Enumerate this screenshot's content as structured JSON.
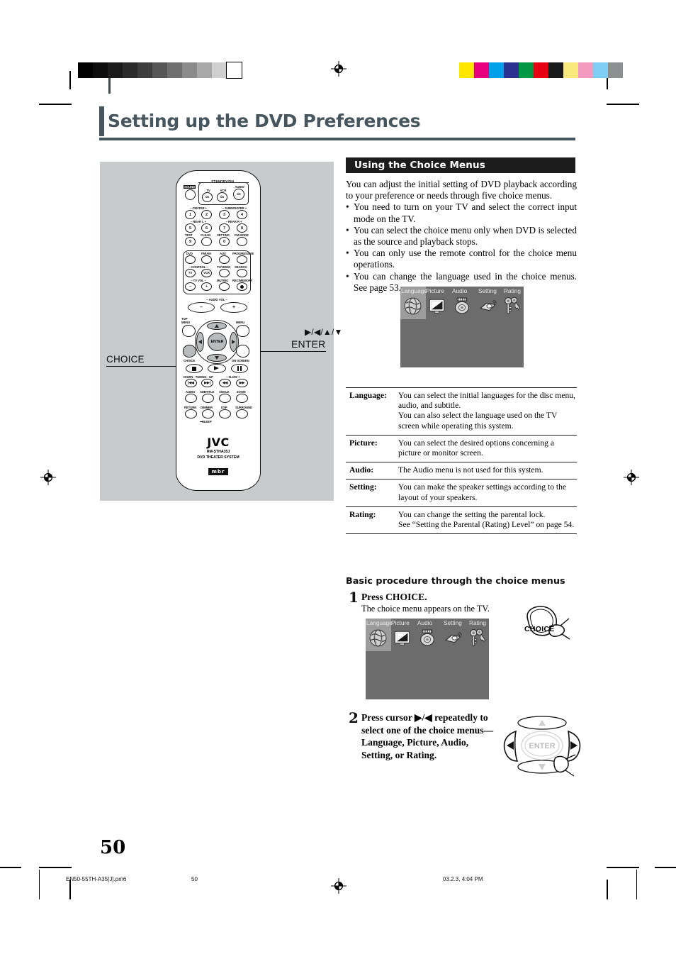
{
  "page": {
    "title": "Setting up the DVD Preferences",
    "number": "50"
  },
  "footer": {
    "file": "EN50-55TH-A35[J].pm6",
    "page": "50",
    "timestamp": "03.2.3, 4:04 PM"
  },
  "section": {
    "heading": "Using the Choice Menus",
    "intro_p1": "You can adjust the initial setting of DVD playback according to your preference or needs through five choice menus.",
    "bullets": [
      "You need to turn on your TV and select the correct input mode on the TV.",
      "You can select the choice menu only when DVD is selected as the source and playback stops.",
      "You can only use the remote control for the choice menu operations.",
      "You can change the language used in the choice menus. See page 53."
    ]
  },
  "tv_menu": {
    "tabs": [
      "Language",
      "Picture",
      "Audio",
      "Setting",
      "Rating"
    ],
    "selected": "Language",
    "icons": [
      "globe-icon",
      "monitor-icon",
      "disc-icon",
      "speaker-icon",
      "keys-icon"
    ],
    "bg_color": "#6c6c6c",
    "highlight_color": "#9c9c9c"
  },
  "definitions": [
    {
      "term": "Language:",
      "desc": "You can select the initial languages for the disc menu, audio, and subtitle.\nYou can also select the language used on the TV screen while operating this system."
    },
    {
      "term": "Picture:",
      "desc": "You can select the desired options concerning a picture or monitor screen."
    },
    {
      "term": "Audio:",
      "desc": "The Audio menu is not used for this system."
    },
    {
      "term": "Setting:",
      "desc": "You can make the speaker settings according to the layout of your speakers."
    },
    {
      "term": "Rating:",
      "desc": "You can change the setting the parental lock.\nSee “Setting the Parental (Rating) Level” on page 54."
    }
  ],
  "procedure": {
    "heading": "Basic procedure through the choice menus",
    "steps": [
      {
        "number": "1",
        "text": "Press CHOICE.",
        "sub": "The choice menu appears on the TV.",
        "art_caption": "CHOICE"
      },
      {
        "number": "2",
        "text": "Press cursor ▶/◀ repeatedly to select one of the choice menus—Language, Picture, Audio, Setting, or Rating.",
        "sub": "",
        "art_caption": "ENTER"
      }
    ]
  },
  "remote": {
    "callouts": {
      "cursor": "▶/◀/▲/▼",
      "enter": "ENTER",
      "choice": "CHOICE"
    },
    "labels": {
      "sound": "SOUND",
      "standby_on": "STANDBY/ON",
      "tv": "TV",
      "vcr": "VCR",
      "audio": "AUDIO",
      "power_glyph": "⏻/I",
      "center_minus": "– CENTER +",
      "subwoofer_minus": "– SUBWOOFER +",
      "rear_l": "– REAR L +",
      "rear_r": "– REAR R +",
      "test": "TEST",
      "clear": "CLEAR",
      "setting": "SETTING",
      "fm_mode": "FM MODE",
      "keys": [
        "1",
        "2",
        "3",
        "4",
        "5",
        "6",
        "7",
        "8",
        "9",
        "0"
      ],
      "dvd": "DVD",
      "fmam": "FM/AM",
      "aux": "AUX",
      "progressive": "PROGRESSIVE",
      "control": "– CONTROL –",
      "ctl_tv": "TV",
      "ctl_vcr": "VCR",
      "tv_video": "TV/VIDEO",
      "search": "SEARCH",
      "tv_vol": "– TV VOL –",
      "minus": "–",
      "plus": "+",
      "muting": "MUTING",
      "rec_memory": "REC/MEMORY",
      "audio_vol": "– AUDIO VOL –",
      "top_menu": "TOP\nMENU",
      "menu": "MENU",
      "enter": "ENTER",
      "choice": "CHOICE",
      "on_screen": "ON SCREEN",
      "down_tuning_up": "DOWN · TUNING · UP",
      "slow": "– SLOW +",
      "audio_btn": "AUDIO",
      "subtitle": "SUBTITLE",
      "angle": "ANGLE",
      "zoom": "ZOOM",
      "return": "RETURN",
      "dimmer": "DIMMER",
      "dsp": "DSP",
      "surround": "SURROUND",
      "sleep": "SLEEP",
      "brand": "JVC",
      "model": "RM-STHA35J",
      "system": "DVD THEATER SYSTEM",
      "mbr": "mbr"
    }
  },
  "print_marks": {
    "grayscale": [
      "#000000",
      "#0d0d0d",
      "#1b1b1b",
      "#2b2b2b",
      "#3d3d3d",
      "#565656",
      "#6f6f6f",
      "#8a8a8a",
      "#a8a8a8",
      "#cfcfcf",
      "#ffffff"
    ],
    "colors": [
      "#ffe600",
      "#e6007e",
      "#00a0e9",
      "#2b3190",
      "#009844",
      "#e60012",
      "#1a1a1a",
      "#faea7d",
      "#f49ac1",
      "#7ecef4",
      "#8d9091"
    ]
  }
}
